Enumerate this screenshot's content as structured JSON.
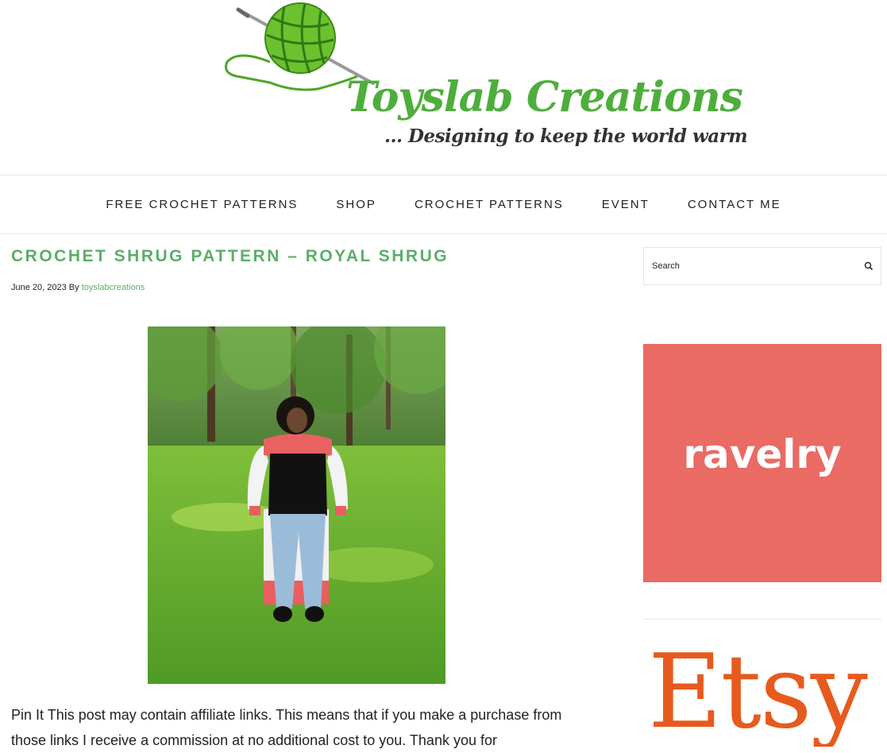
{
  "header": {
    "logo_title": "Toyslab Creations",
    "logo_tagline": "... Designing to keep the world warm"
  },
  "nav": {
    "items": [
      "FREE CROCHET PATTERNS",
      "SHOP",
      "CROCHET PATTERNS",
      "EVENT",
      "CONTACT ME"
    ]
  },
  "post": {
    "title": "CROCHET SHRUG PATTERN – ROYAL SHRUG",
    "date": "June 20, 2023",
    "by": "By",
    "author": "toyslabcreations",
    "body_text": "Pin It This post may contain affiliate links. This means that if you make a purchase from those links I receive a commission at no additional cost to you. Thank you for"
  },
  "sidebar": {
    "search_placeholder": "Search",
    "ravelry_label": "ravelry",
    "etsy_label": "Etsy"
  },
  "colors": {
    "accent_green": "#5bae6a",
    "ravelry_bg": "#ea6a64",
    "etsy_orange": "#e75a1d"
  }
}
